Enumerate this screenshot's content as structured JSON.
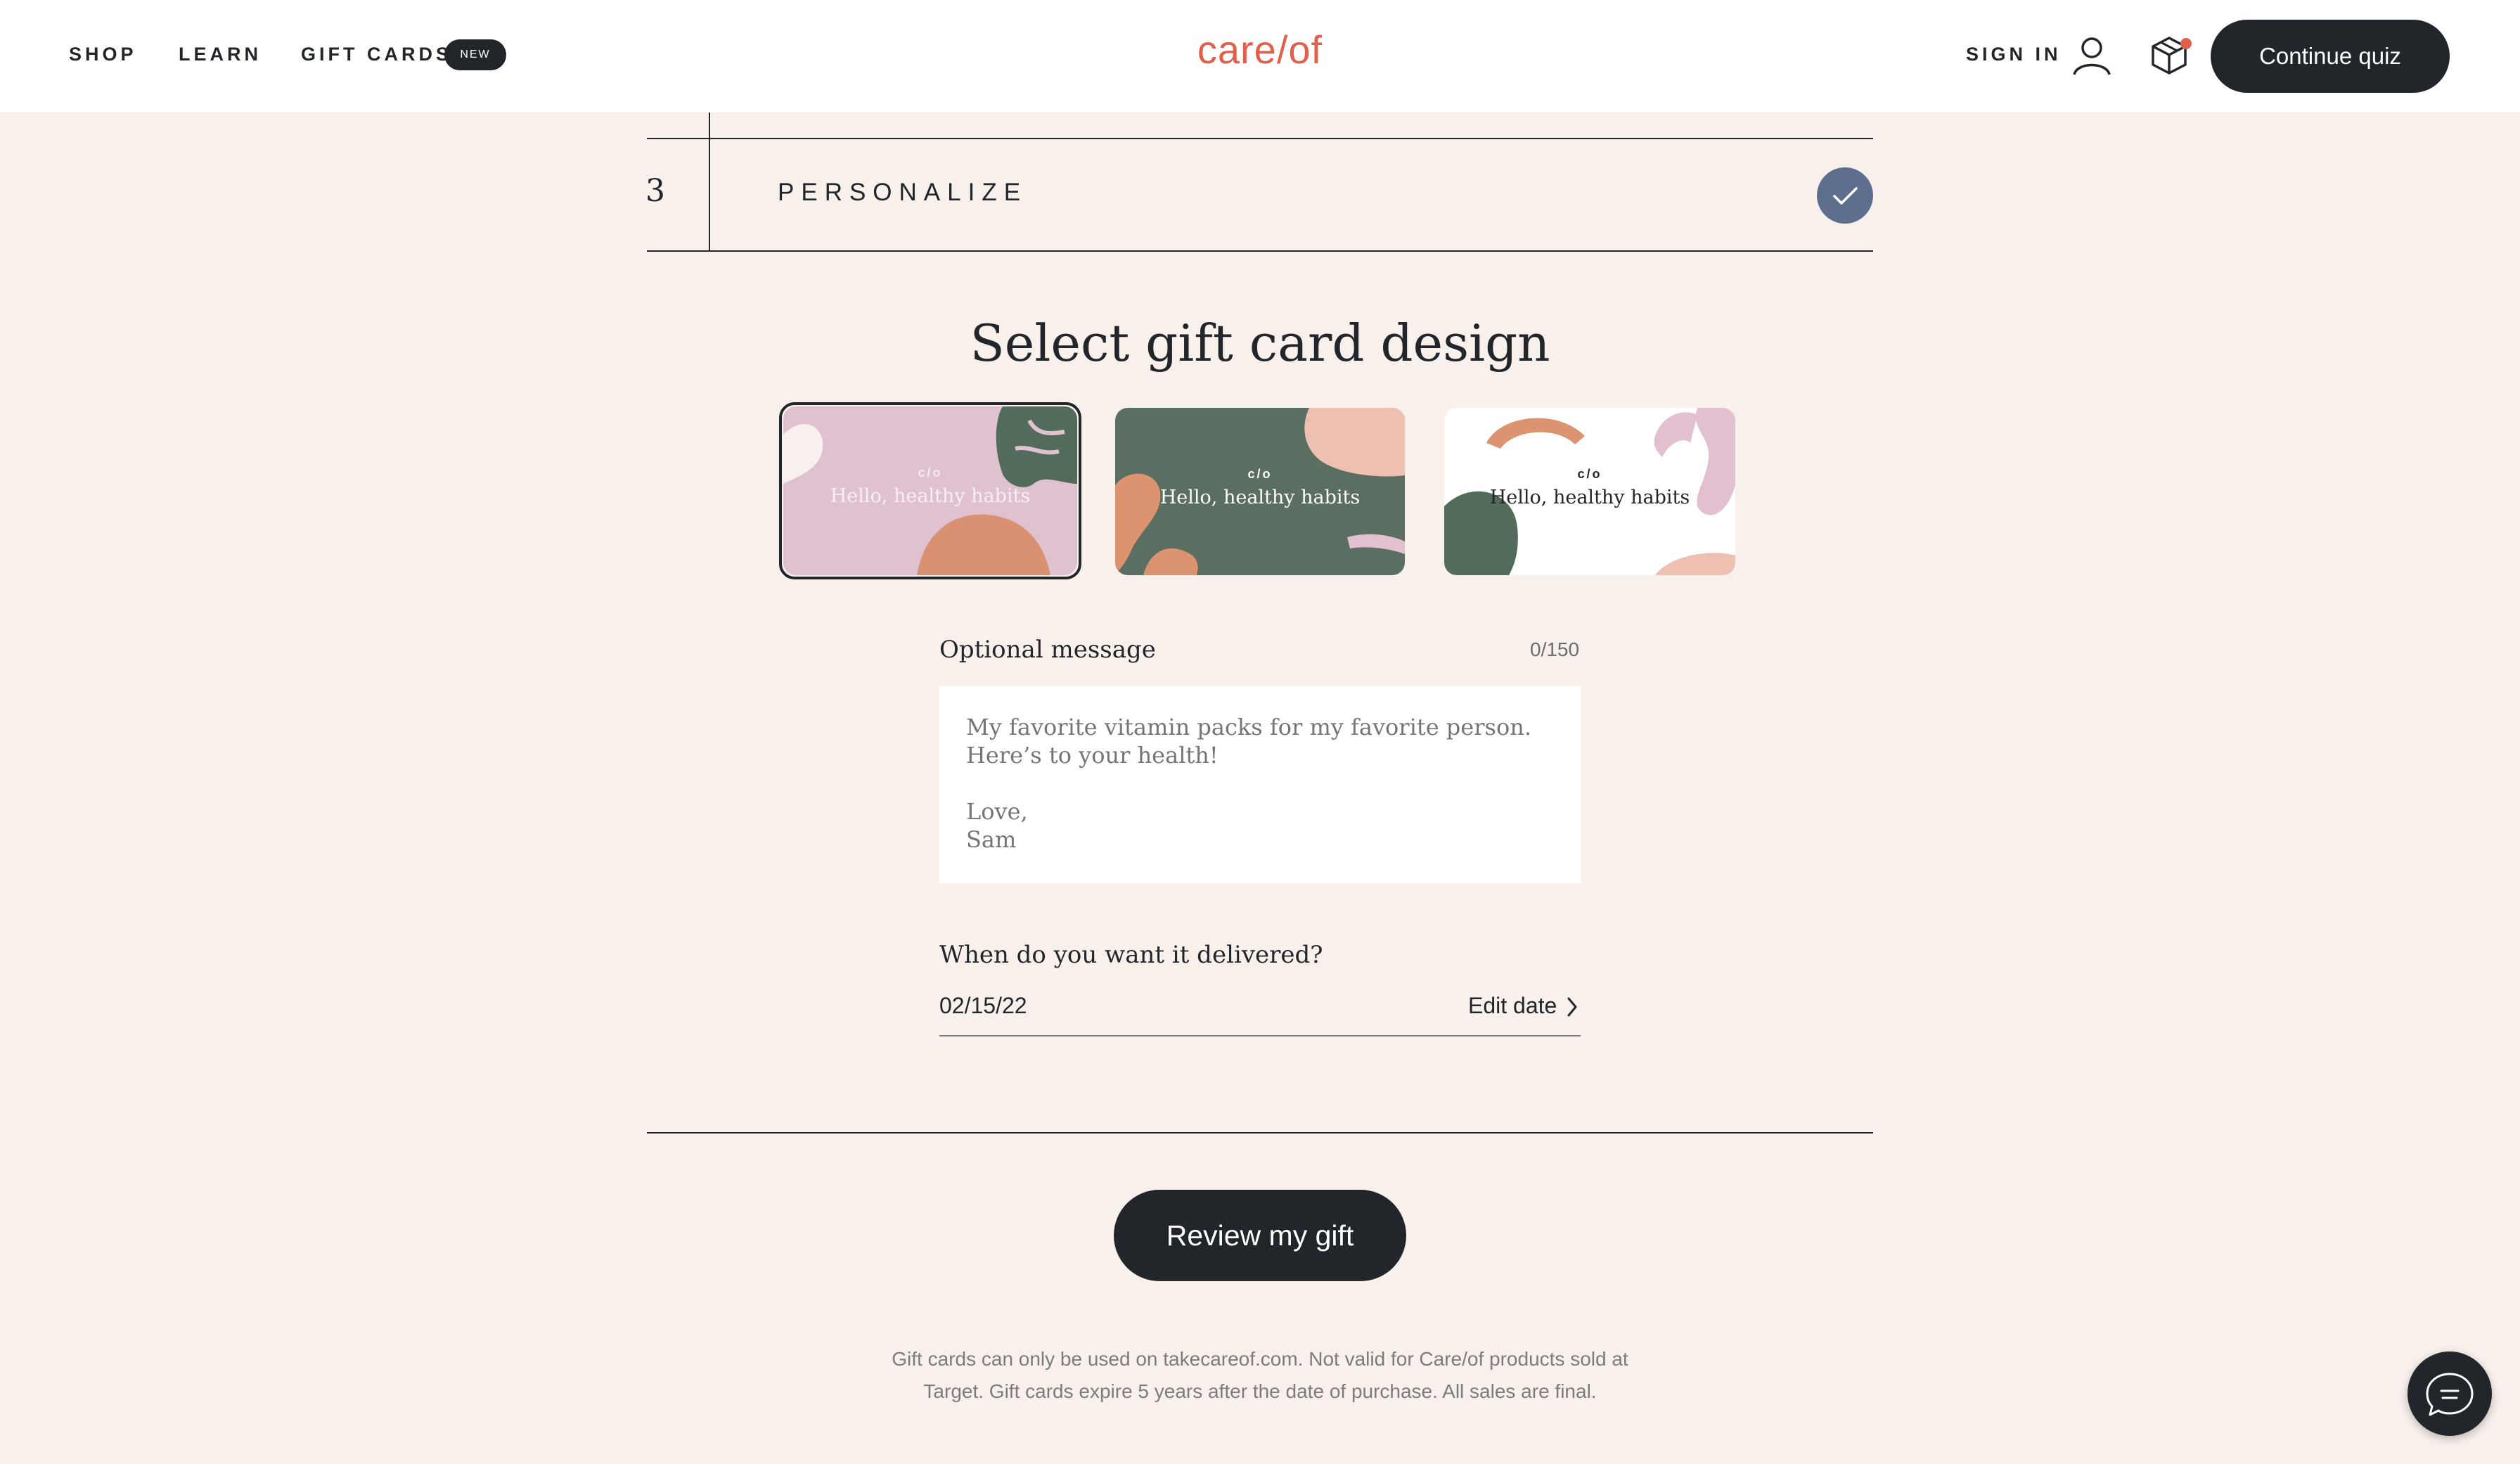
{
  "header": {
    "nav": [
      {
        "label": "SHOP"
      },
      {
        "label": "LEARN"
      },
      {
        "label": "GIFT CARDS"
      }
    ],
    "new_badge": "NEW",
    "logo_text": "care/of",
    "sign_in": "SIGN IN",
    "continue_button": "Continue quiz"
  },
  "step": {
    "number": "3",
    "title": "PERSONALIZE",
    "completed": true
  },
  "design": {
    "title": "Select gift card design",
    "cards": [
      {
        "monogram": "c/o",
        "greeting": "Hello, healthy habits",
        "selected": true,
        "theme": "pink"
      },
      {
        "monogram": "c/o",
        "greeting": "Hello, healthy habits",
        "selected": false,
        "theme": "green"
      },
      {
        "monogram": "c/o",
        "greeting": "Hello, healthy habits",
        "selected": false,
        "theme": "white"
      }
    ]
  },
  "message": {
    "label": "Optional message",
    "counter": "0/150",
    "placeholder": "My favorite vitamin packs for my favorite person. Here’s to your health!\n\nLove,\nSam"
  },
  "delivery": {
    "label": "When do you want it delivered?",
    "date": "02/15/22",
    "edit_label": "Edit date"
  },
  "review_button": "Review my gift",
  "disclaimer": "Gift cards can only be used on takecareof.com. Not valid for Care/of products sold at Target. Gift cards expire 5 years after the date of purchase. All sales are final.",
  "colors": {
    "background": "#f8f0eb",
    "dark": "#22262a",
    "brand": "#e0604c",
    "check": "#5d6e8e",
    "card_pink": "#e0c1d0",
    "card_green": "#5a6e61",
    "accent_orange": "#db946f"
  },
  "icons": [
    "user-icon",
    "box-icon",
    "check-icon",
    "chevron-right-icon",
    "chat-icon"
  ]
}
